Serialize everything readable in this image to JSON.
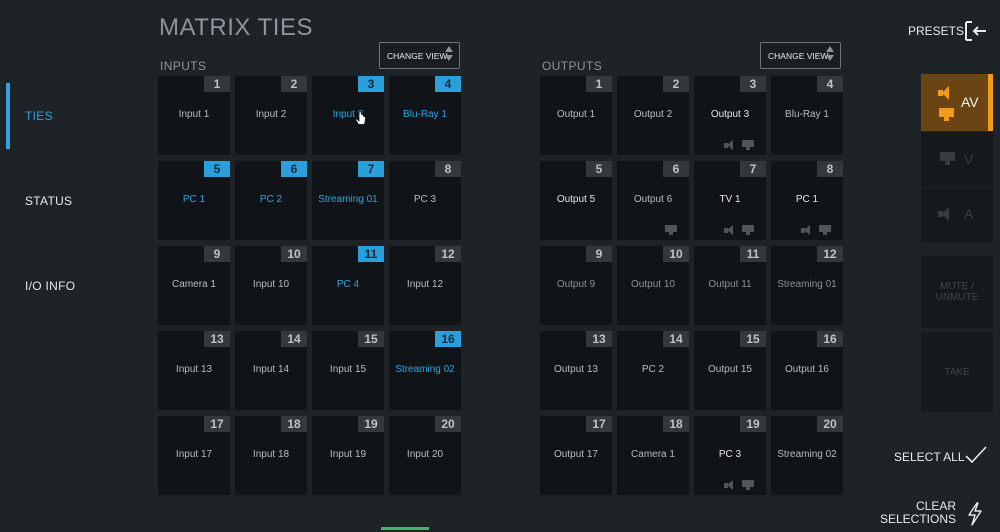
{
  "page": {
    "title": "MATRIX TIES"
  },
  "sidebar": {
    "items": [
      {
        "label": "TIES",
        "active": true
      },
      {
        "label": "STATUS",
        "active": false
      },
      {
        "label": "I/O INFO",
        "active": false
      }
    ]
  },
  "inputs": {
    "label": "INPUTS",
    "change_view": "CHANGE VIEW",
    "tiles": [
      {
        "num": "1",
        "label": "Input 1",
        "selected": false
      },
      {
        "num": "2",
        "label": "Input 2",
        "selected": false
      },
      {
        "num": "3",
        "label": "Input 3",
        "selected": true
      },
      {
        "num": "4",
        "label": "Blu-Ray 1",
        "selected": true
      },
      {
        "num": "5",
        "label": "PC 1",
        "selected": true
      },
      {
        "num": "6",
        "label": "PC 2",
        "selected": true
      },
      {
        "num": "7",
        "label": "Streaming 01",
        "selected": true
      },
      {
        "num": "8",
        "label": "PC 3",
        "selected": false
      },
      {
        "num": "9",
        "label": "Camera 1",
        "selected": false
      },
      {
        "num": "10",
        "label": "Input 10",
        "selected": false
      },
      {
        "num": "11",
        "label": "PC 4",
        "selected": true
      },
      {
        "num": "12",
        "label": "Input 12",
        "selected": false
      },
      {
        "num": "13",
        "label": "Input 13",
        "selected": false
      },
      {
        "num": "14",
        "label": "Input 14",
        "selected": false
      },
      {
        "num": "15",
        "label": "Input 15",
        "selected": false
      },
      {
        "num": "16",
        "label": "Streaming 02",
        "selected": true
      },
      {
        "num": "17",
        "label": "Input 17",
        "selected": false
      },
      {
        "num": "18",
        "label": "Input 18",
        "selected": false
      },
      {
        "num": "19",
        "label": "Input 19",
        "selected": false
      },
      {
        "num": "20",
        "label": "Input 20",
        "selected": false
      }
    ]
  },
  "outputs": {
    "label": "OUTPUTS",
    "change_view": "CHANGE VIEW",
    "tiles": [
      {
        "num": "1",
        "label": "Output 1",
        "style": "normal",
        "icons": []
      },
      {
        "num": "2",
        "label": "Output 2",
        "style": "normal",
        "icons": []
      },
      {
        "num": "3",
        "label": "Output 3",
        "style": "bright",
        "icons": [
          "speaker-icon",
          "monitor-icon"
        ]
      },
      {
        "num": "4",
        "label": "Blu-Ray 1",
        "style": "normal",
        "icons": []
      },
      {
        "num": "5",
        "label": "Output 5",
        "style": "bright",
        "icons": []
      },
      {
        "num": "6",
        "label": "Output 6",
        "style": "normal",
        "icons": [
          "monitor-icon"
        ]
      },
      {
        "num": "7",
        "label": "TV 1",
        "style": "bright",
        "icons": [
          "speaker-icon",
          "monitor-icon"
        ]
      },
      {
        "num": "8",
        "label": "PC 1",
        "style": "bright",
        "icons": [
          "speaker-icon",
          "monitor-icon"
        ]
      },
      {
        "num": "9",
        "label": "Output 9",
        "style": "dim",
        "icons": []
      },
      {
        "num": "10",
        "label": "Output 10",
        "style": "dim",
        "icons": []
      },
      {
        "num": "11",
        "label": "Output 11",
        "style": "dim",
        "icons": []
      },
      {
        "num": "12",
        "label": "Streaming 01",
        "style": "dim",
        "icons": []
      },
      {
        "num": "13",
        "label": "Output 13",
        "style": "normal",
        "icons": []
      },
      {
        "num": "14",
        "label": "PC 2",
        "style": "normal",
        "icons": []
      },
      {
        "num": "15",
        "label": "Output 15",
        "style": "normal",
        "icons": []
      },
      {
        "num": "16",
        "label": "Output 16",
        "style": "normal",
        "icons": []
      },
      {
        "num": "17",
        "label": "Output 17",
        "style": "normal",
        "icons": []
      },
      {
        "num": "18",
        "label": "Camera 1",
        "style": "normal",
        "icons": []
      },
      {
        "num": "19",
        "label": "PC 3",
        "style": "bright",
        "icons": [
          "speaker-icon",
          "monitor-icon"
        ]
      },
      {
        "num": "20",
        "label": "Streaming 02",
        "style": "normal",
        "icons": []
      }
    ]
  },
  "right_panel": {
    "presets": "PRESETS",
    "av": "AV",
    "v": "V",
    "a": "A",
    "mute": "MUTE / UNMUTE",
    "take": "TAKE",
    "select_all": "SELECT ALL",
    "clear_line1": "CLEAR",
    "clear_line2": "SELECTIONS"
  },
  "colors": {
    "accent": "#2ea3e0",
    "av_active": "#f29a1a",
    "background": "#1e2328",
    "tile": "#101418"
  }
}
